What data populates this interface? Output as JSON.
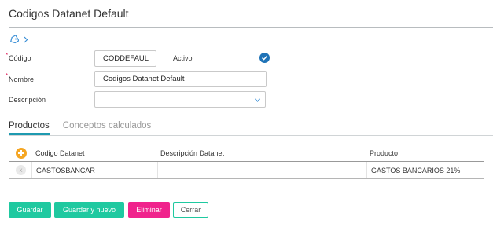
{
  "page": {
    "title": "Codigos Datanet Default"
  },
  "icons": {
    "tag": "tag-icon",
    "chevron": "chevron-right-icon",
    "check": "check-circle-icon",
    "add": "plus-circle-icon",
    "delete": "x-icon",
    "dropdown": "chevron-down-icon"
  },
  "form": {
    "codigo_label": "Código",
    "codigo_value": "CODDEFAUL",
    "activo_label": "Activo",
    "activo_checked": true,
    "nombre_label": "Nombre",
    "nombre_value": "Codigos Datanet Default",
    "descripcion_label": "Descripción",
    "descripcion_value": "",
    "required_marker": "*"
  },
  "tabs": [
    {
      "label": "Productos",
      "active": true
    },
    {
      "label": "Conceptos calculados",
      "active": false
    }
  ],
  "grid": {
    "columns": [
      "Codigo Datanet",
      "Descripción Datanet",
      "Producto"
    ],
    "rows": [
      {
        "codigo": "GASTOSBANCAR",
        "descripcion": "",
        "producto": "GASTOS BANCARIOS 21%"
      }
    ],
    "delete_glyph": "x"
  },
  "buttons": {
    "guardar": "Guardar",
    "guardar_nuevo": "Guardar y nuevo",
    "eliminar": "Eliminar",
    "cerrar": "Cerrar"
  },
  "colors": {
    "accent": "#1fc9a0",
    "danger": "#f0238c",
    "tab_underline": "#1e9ab0",
    "check": "#1f73b7",
    "add": "#f5a623"
  }
}
